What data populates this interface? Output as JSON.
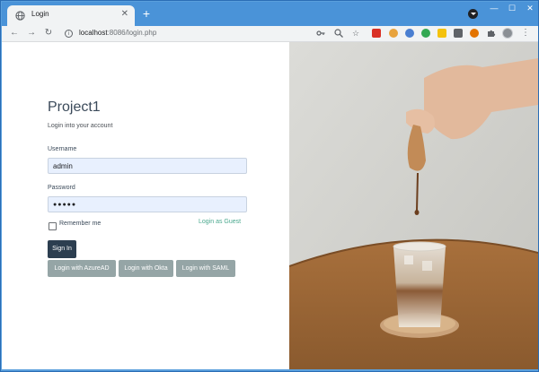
{
  "browser": {
    "tab_title": "Login",
    "tab_close": "✕",
    "new_tab": "+",
    "url_host": "localhost",
    "url_rest": ":8086/login.php",
    "window_controls": {
      "minimize": "—",
      "maximize": "☐",
      "close": "✕"
    },
    "nav": {
      "back": "←",
      "forward": "→",
      "reload": "↻"
    },
    "toolbar_icons": [
      "key-icon",
      "zoom-icon",
      "star-icon"
    ],
    "extension_colors": [
      "#d93025",
      "#e8a33d",
      "#4a7fd1",
      "#34a853",
      "#f4c20d",
      "#5f6368",
      "#e37400"
    ],
    "menu": "⋮"
  },
  "login": {
    "title": "Project1",
    "subtitle": "Login into your account",
    "username_label": "Username",
    "username_value": "admin",
    "password_label": "Password",
    "password_value": "●●●●●",
    "remember_label": "Remember me",
    "guest_link": "Login as Guest",
    "signin_button": "Sign In",
    "sso_buttons": [
      "Login with AzureAD",
      "Login with Okta",
      "Login with SAML"
    ]
  },
  "colors": {
    "primary_button": "#2c3e50",
    "secondary_button": "#95a5a6",
    "link": "#4aa88e",
    "input_bg": "#e8f0fe"
  }
}
